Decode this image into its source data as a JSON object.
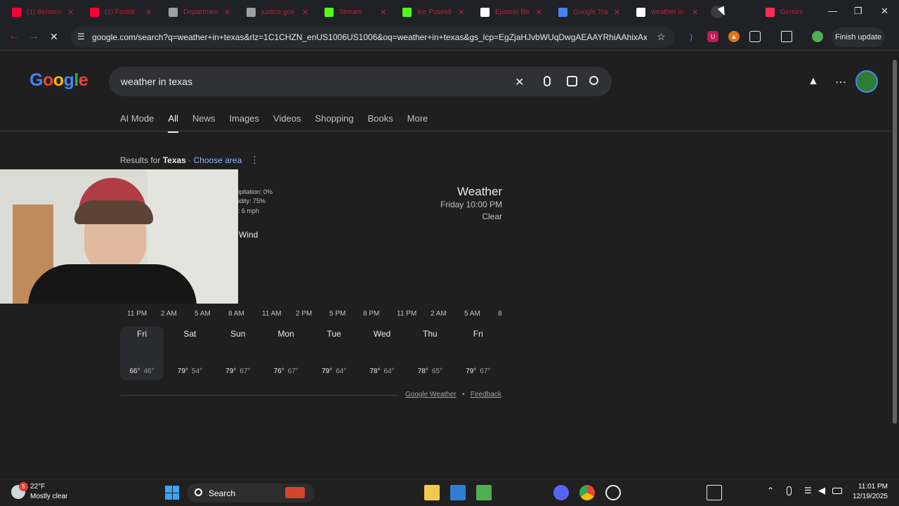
{
  "tabs": [
    {
      "title": "(1) Bensen",
      "icon": "youtube-icon",
      "color": "#ff0033"
    },
    {
      "title": "(1) Fortnit",
      "icon": "youtube-icon",
      "color": "#ff0033"
    },
    {
      "title": "Departmen",
      "icon": "globe-icon",
      "color": "#9aa0a6"
    },
    {
      "title": "justice.gov",
      "icon": "globe-icon",
      "color": "#9aa0a6"
    },
    {
      "title": "Stream",
      "icon": "kick-icon",
      "color": "#53fc18"
    },
    {
      "title": "Ice Poseidi",
      "icon": "kick-icon",
      "color": "#53fc18"
    },
    {
      "title": "Epstein file",
      "icon": "t-icon",
      "color": "#ffffff"
    },
    {
      "title": "Google Tra",
      "icon": "translate-icon",
      "color": "#4285f4"
    },
    {
      "title": "weather in",
      "icon": "google-icon",
      "color": "#ffffff"
    },
    {
      "title": "Gemini",
      "icon": "gemini-icon",
      "color": "#ff2d55"
    }
  ],
  "browser": {
    "url": "google.com/search?q=weather+in+texas&rlz=1C1CHZN_enUS1006US1006&oq=weather+in+texas&gs_lcp=EgZjaHJvbWUqDwgAEAAYRhiAAhixAxiAB...",
    "finish_update": "Finish update"
  },
  "google": {
    "logo": "Google",
    "query": "weather in texas",
    "tabs": [
      "AI Mode",
      "All",
      "News",
      "Images",
      "Videos",
      "Shopping",
      "Books",
      "More"
    ],
    "active_tab": "All"
  },
  "results": {
    "prefix": "Results for",
    "location": "Texas",
    "sep": "·",
    "choose": "Choose area"
  },
  "weather": {
    "precip": "ipitation: 0%",
    "humidity": "idity: 75%",
    "wind_speed": ": 6 mph",
    "wind_tab": "Wind",
    "title": "Weather",
    "time": "Friday 10:00 PM",
    "condition": "Clear",
    "hours": [
      "11 PM",
      "2 AM",
      "5 AM",
      "8 AM",
      "11 AM",
      "2 PM",
      "5 PM",
      "8 PM",
      "11 PM",
      "2 AM",
      "5 AM",
      "8"
    ],
    "days": [
      {
        "name": "Fri",
        "hi": "66°",
        "lo": "46°"
      },
      {
        "name": "Sat",
        "hi": "79°",
        "lo": "54°"
      },
      {
        "name": "Sun",
        "hi": "79°",
        "lo": "67°"
      },
      {
        "name": "Mon",
        "hi": "76°",
        "lo": "67°"
      },
      {
        "name": "Tue",
        "hi": "79°",
        "lo": "64°"
      },
      {
        "name": "Wed",
        "hi": "78°",
        "lo": "64°"
      },
      {
        "name": "Thu",
        "hi": "78°",
        "lo": "65°"
      },
      {
        "name": "Fri",
        "hi": "79°",
        "lo": "67°"
      }
    ],
    "footer_source": "Google Weather",
    "footer_dot": "•",
    "footer_feedback": "Feedback"
  },
  "taskbar": {
    "temp": "22°F",
    "cond": "Mostly clear",
    "badge": "5",
    "search": "Search",
    "time": "11:01 PM",
    "date": "12/19/2025"
  }
}
